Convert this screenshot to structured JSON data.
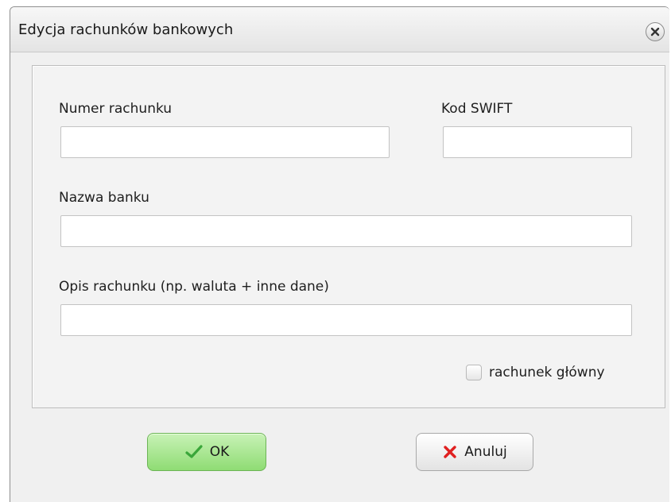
{
  "window": {
    "title": "Edycja rachunków bankowych",
    "close_icon": "close-icon"
  },
  "form": {
    "account_number": {
      "label": "Numer rachunku",
      "value": "",
      "placeholder": ""
    },
    "swift_code": {
      "label": "Kod SWIFT",
      "value": "",
      "placeholder": ""
    },
    "bank_name": {
      "label": "Nazwa banku",
      "value": "",
      "placeholder": ""
    },
    "account_description": {
      "label": "Opis rachunku (np. waluta + inne dane)",
      "value": "",
      "placeholder": ""
    },
    "main_account": {
      "label": "rachunek główny",
      "checked": false
    }
  },
  "buttons": {
    "ok": {
      "label": "OK",
      "icon": "checkmark-icon",
      "color": "#3aa63a"
    },
    "cancel": {
      "label": "Anuluj",
      "icon": "x-icon",
      "color": "#e02020"
    }
  },
  "colors": {
    "ok_button": "#9fe085",
    "window_background": "#f0f0f0"
  }
}
